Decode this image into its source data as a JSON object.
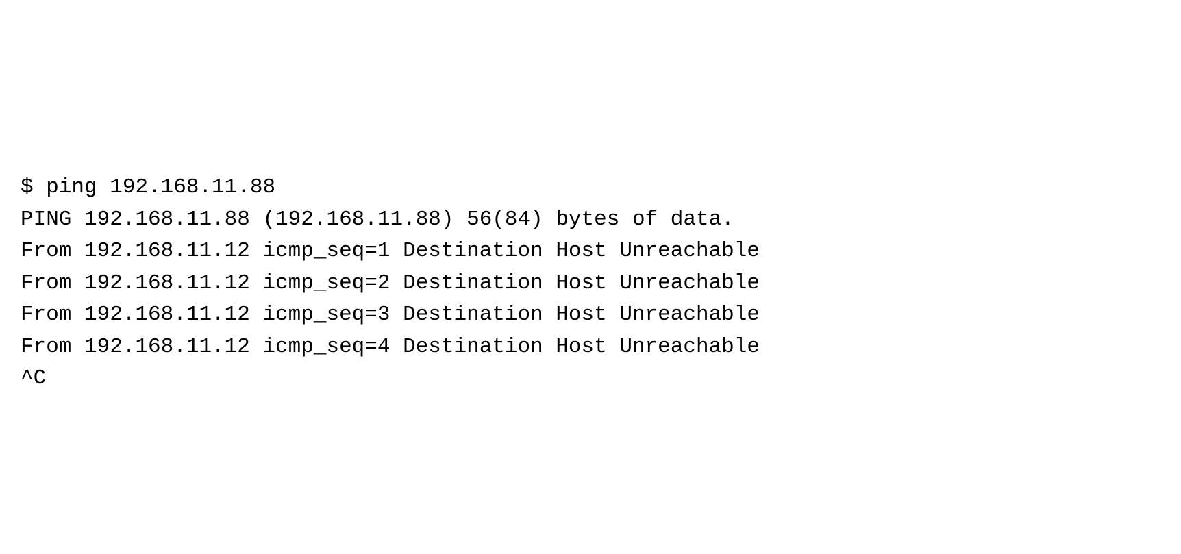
{
  "terminal": {
    "prompt": "$ ",
    "command": "ping 192.168.11.88",
    "lines": [
      "PING 192.168.11.88 (192.168.11.88) 56(84) bytes of data.",
      "From 192.168.11.12 icmp_seq=1 Destination Host Unreachable",
      "From 192.168.11.12 icmp_seq=2 Destination Host Unreachable",
      "From 192.168.11.12 icmp_seq=3 Destination Host Unreachable",
      "From 192.168.11.12 icmp_seq=4 Destination Host Unreachable",
      "^C"
    ]
  }
}
